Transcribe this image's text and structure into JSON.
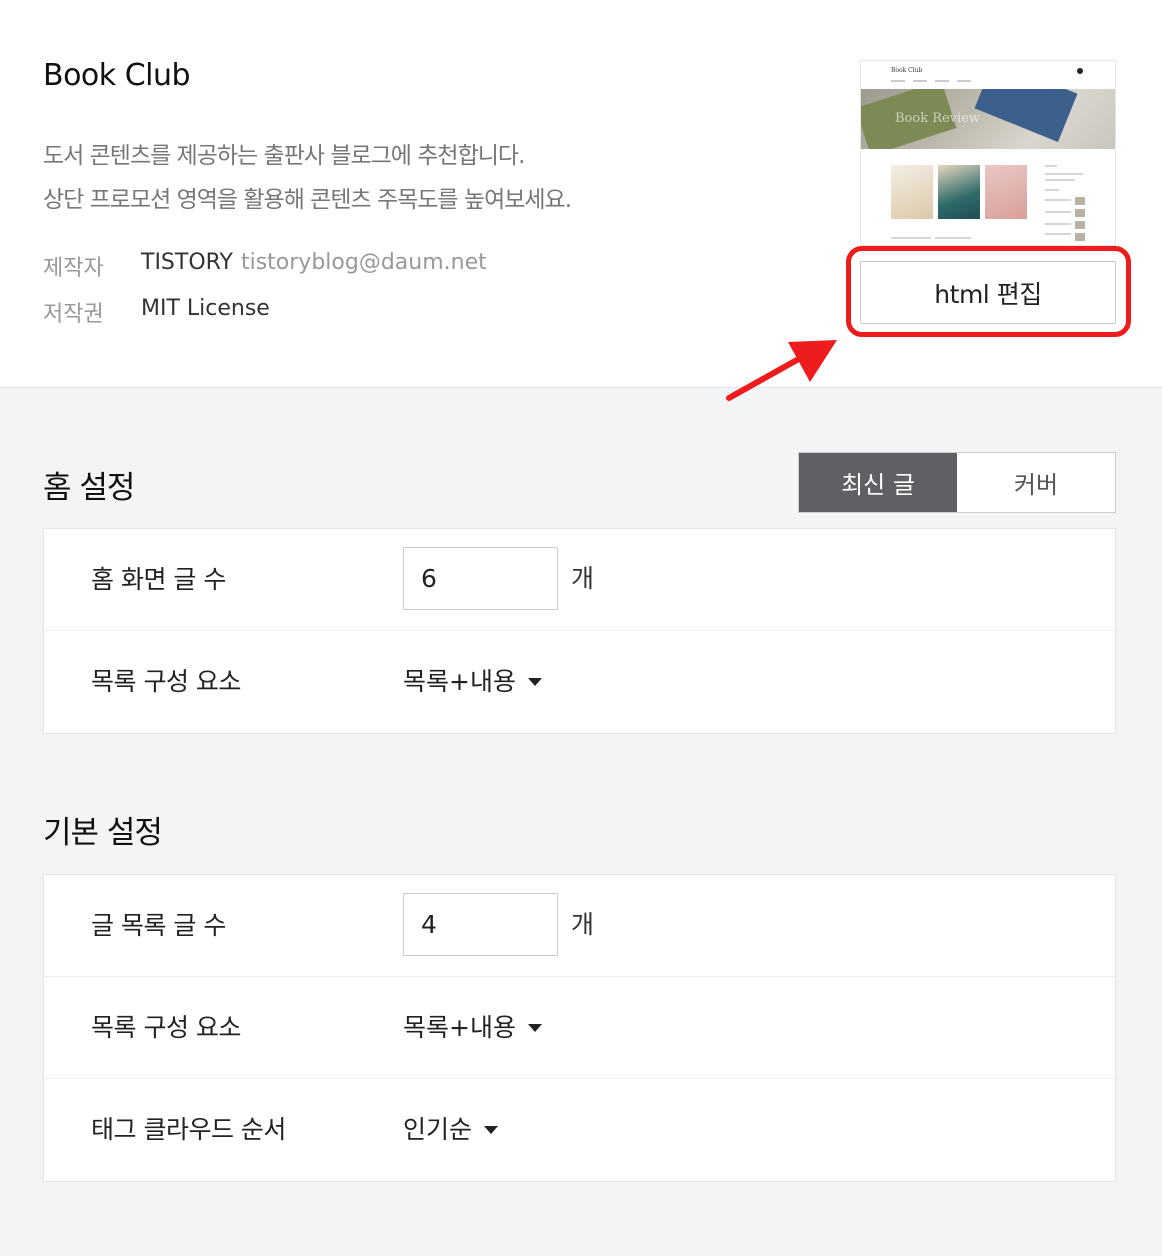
{
  "theme": {
    "title": "Book Club",
    "description_lines": [
      "도서 콘텐츠를 제공하는 출판사 블로그에 추천합니다.",
      "상단 프로모션 영역을 활용해 콘텐츠 주목도를 높여보세요."
    ],
    "author_label": "제작자",
    "author_name": "TISTORY",
    "author_email": "tistoryblog@daum.net",
    "license_label": "저작권",
    "license_value": "MIT License",
    "preview": {
      "logo_text": "Book Club",
      "banner_text": "Book Review"
    },
    "edit_button": "html 편집"
  },
  "home_settings": {
    "title": "홈 설정",
    "toggle_options": [
      "최신 글",
      "커버"
    ],
    "active_toggle": "최신 글",
    "rows": {
      "post_count": {
        "label": "홈 화면 글 수",
        "value": "6",
        "unit": "개"
      },
      "list_elements": {
        "label": "목록 구성 요소",
        "value": "목록+내용"
      }
    }
  },
  "basic_settings": {
    "title": "기본 설정",
    "rows": {
      "post_count": {
        "label": "글 목록 글 수",
        "value": "4",
        "unit": "개"
      },
      "list_elements": {
        "label": "목록 구성 요소",
        "value": "목록+내용"
      },
      "tag_cloud_order": {
        "label": "태그 클라우드 순서",
        "value": "인기순"
      }
    }
  },
  "colors": {
    "annotation_red": "#ee1c1c",
    "toggle_active_bg": "#5e6064",
    "page_bg": "#f3f4f6"
  }
}
